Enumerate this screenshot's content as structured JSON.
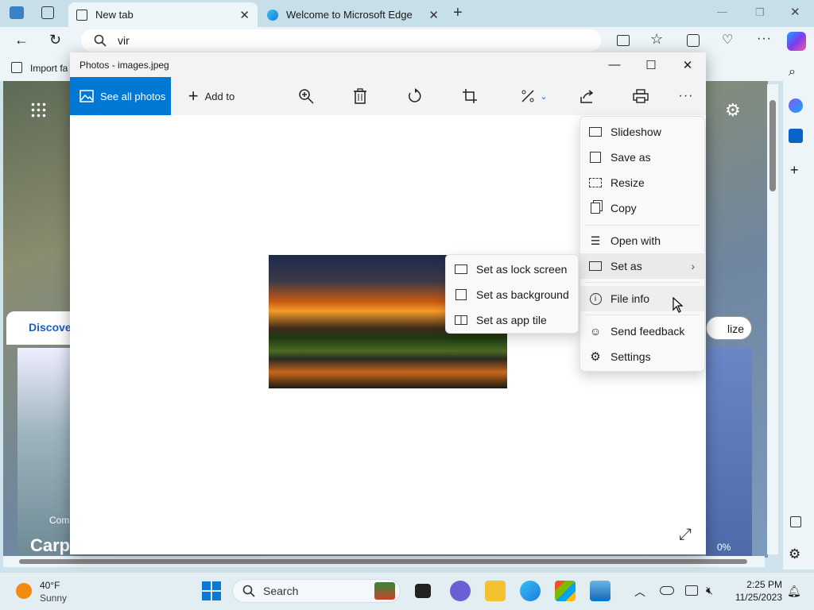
{
  "browser": {
    "tabs": [
      {
        "label": "New tab",
        "active": true
      },
      {
        "label": "Welcome to Microsoft Edge",
        "active": false
      }
    ],
    "address_value": "vir",
    "favorites_import_label": "Import fa"
  },
  "background_page": {
    "discover_label": "Discover",
    "personalize_label": "lize",
    "card_caption": "Carp",
    "card_source": "Com",
    "weather_percent": "0%"
  },
  "photos": {
    "title": "Photos - images.jpeg",
    "toolbar": {
      "see_all": "See all photos",
      "add_to": "Add to"
    },
    "more_menu": [
      {
        "label": "Slideshow",
        "icon": "slideshow-icon"
      },
      {
        "label": "Save as",
        "icon": "save-icon"
      },
      {
        "label": "Resize",
        "icon": "resize-icon"
      },
      {
        "label": "Copy",
        "icon": "copy-icon"
      },
      {
        "label": "Open with",
        "icon": "open-with-icon"
      },
      {
        "label": "Set as",
        "icon": "set-as-icon",
        "has_submenu": true
      },
      {
        "label": "File info",
        "icon": "info-icon",
        "highlighted": true
      },
      {
        "label": "Send feedback",
        "icon": "feedback-icon"
      },
      {
        "label": "Settings",
        "icon": "settings-icon"
      }
    ],
    "set_as_submenu": [
      {
        "label": "Set as lock screen",
        "icon": "lock-screen-icon"
      },
      {
        "label": "Set as background",
        "icon": "background-icon"
      },
      {
        "label": "Set as app tile",
        "icon": "app-tile-icon"
      }
    ]
  },
  "taskbar": {
    "weather_temp": "40°F",
    "weather_desc": "Sunny",
    "search_placeholder": "Search",
    "time": "2:25 PM",
    "date": "11/25/2023"
  },
  "colors": {
    "accent": "#0078d4",
    "edge_frame": "#c7dfe9",
    "menu_bg": "#f9f9f9"
  }
}
